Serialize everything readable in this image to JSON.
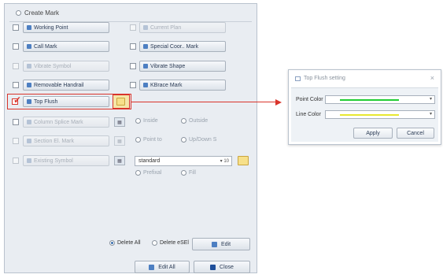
{
  "panel": {
    "title": "Create Mark"
  },
  "rows": {
    "working_point": "Working Point",
    "current_plan": "Current Plan",
    "call_mark": "Call Mark",
    "special_coord_mark": "Special Coor.. Mark",
    "vibrate_symbol": "Vibrate Symbol",
    "vibrate_shape": "Vibrate Shape",
    "removable_handrail": "Removable Handrail",
    "kbrace_mark": "KBrace Mark",
    "top_flush": "Top Flush",
    "column_splice_mark": "Column Splice Mark",
    "column_splice_opt_1": "Inside",
    "column_splice_opt_2": "Outside",
    "section_elevation": "Section El. Mark",
    "section_opt_1": "Point to",
    "section_opt_2": "Up/Down S",
    "existing_symbol": "Existing Symbol",
    "existing_symbol_value": "standard",
    "existing_symbol_size": "10",
    "existing_opt_1": "Prefixal",
    "existing_opt_2": "Fill"
  },
  "bottom": {
    "delete_all": "Delete All",
    "delete_sel": "Delete eSEl",
    "edit": "Edit",
    "edit_all": "Edit All",
    "close": "Close"
  },
  "dialog": {
    "title": "Top Flush setting",
    "close_glyph": "×",
    "point_color_label": "Point Color",
    "line_color_label": "Line Color",
    "point_color": "#22cc33",
    "line_color": "#e8e830",
    "apply": "Apply",
    "cancel": "Cancel"
  },
  "colors": {
    "highlight": "#d9342b",
    "accent": "#4d7fc2"
  }
}
